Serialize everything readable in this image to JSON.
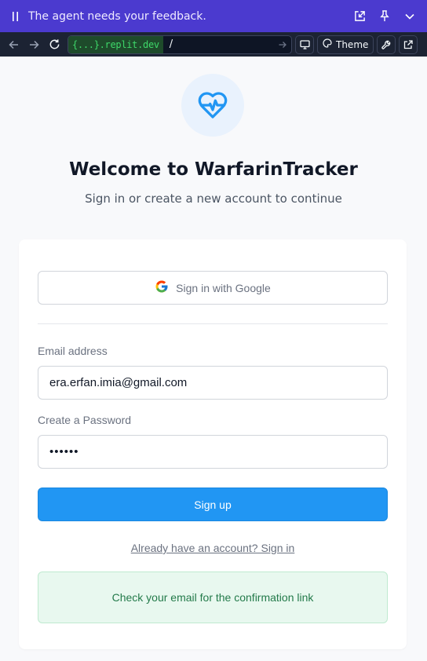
{
  "agent_bar": {
    "message": "The agent needs your feedback.",
    "icons": [
      "pause-icon",
      "open-in-window-icon",
      "pin-icon",
      "chevron-down-icon"
    ]
  },
  "browser": {
    "url_domain": "{...}.replit.dev",
    "url_path": "/",
    "theme_label": "Theme",
    "icons": [
      "back-arrow-icon",
      "forward-arrow-icon",
      "reload-icon",
      "go-arrow-icon",
      "device-icon",
      "palette-icon",
      "wrench-icon",
      "external-link-icon"
    ]
  },
  "page": {
    "logo_icon": "heart-pulse-icon",
    "title": "Welcome to WarfarinTracker",
    "subtitle": "Sign in or create a new account to continue"
  },
  "form": {
    "google_label": "Sign in with Google",
    "email_label": "Email address",
    "email_value": "era.erfan.imia@gmail.com",
    "password_label": "Create a Password",
    "password_value": "••••••",
    "submit_label": "Sign up",
    "signin_link": "Already have an account? Sign in",
    "notice": "Check your email for the confirmation link"
  },
  "colors": {
    "agent_bar": "#4b3acf",
    "toolbar": "#1c2333",
    "primary": "#2196f3",
    "logo": "#2196f3",
    "success_bg": "#e8f8ef",
    "success_text": "#237a4a"
  }
}
